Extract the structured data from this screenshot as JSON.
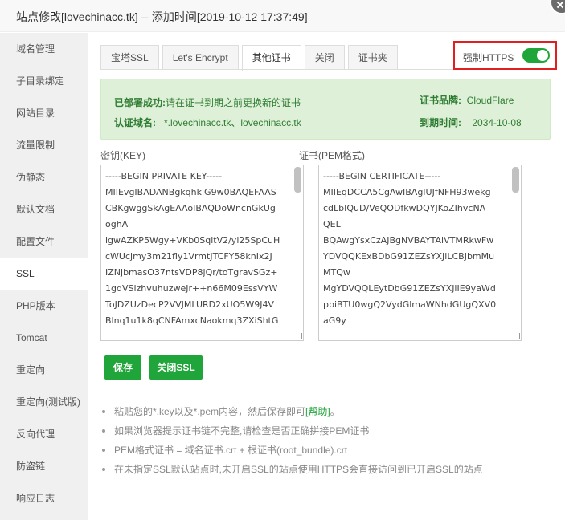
{
  "window": {
    "title": "站点修改[lovechinacc.tk] -- 添加时间[2019-10-12 17:37:49]"
  },
  "sidebar": {
    "items": [
      {
        "label": "域名管理"
      },
      {
        "label": "子目录绑定"
      },
      {
        "label": "网站目录"
      },
      {
        "label": "流量限制"
      },
      {
        "label": "伪静态"
      },
      {
        "label": "默认文档"
      },
      {
        "label": "配置文件"
      },
      {
        "label": "SSL"
      },
      {
        "label": "PHP版本"
      },
      {
        "label": "Tomcat"
      },
      {
        "label": "重定向"
      },
      {
        "label": "重定向(测试版)"
      },
      {
        "label": "反向代理"
      },
      {
        "label": "防盗链"
      },
      {
        "label": "响应日志"
      }
    ],
    "active_item": "SSL"
  },
  "tabs": [
    {
      "label": "宝塔SSL"
    },
    {
      "label": "Let's Encrypt"
    },
    {
      "label": "其他证书"
    },
    {
      "label": "关闭"
    },
    {
      "label": "证书夹"
    }
  ],
  "active_tab": "其他证书",
  "force_https": {
    "label": "强制HTTPS",
    "enabled": true
  },
  "info": {
    "deployed_key": "已部署成功:",
    "deployed_value": "请在证书到期之前更换新的证书",
    "domain_key": "认证域名:",
    "domain_value": "*.lovechinacc.tk、lovechinacc.tk",
    "brand_key": "证书品牌:",
    "brand_value": "CloudFlare",
    "expire_key": "到期时间:",
    "expire_value": "2034-10-08"
  },
  "key_field": {
    "label": "密钥(KEY)",
    "value": "-----BEGIN PRIVATE KEY-----\nMIIEvgIBADANBgkqhkiG9w0BAQEFAAS\nCBKgwggSkAgEAAoIBAQDoWncnGkUg\noghA\nigwAZKP5Wgy+VKb0SqitV2/yl25SpCuH\ncWUcjmy3m21fly1VrmtJTCFY58knIx2J\nIZNjbmasO37ntsVDP8jQr/toTgravSGz+\n1gdVSizhvuhuzweJr++n66M09EssVYW\nToJDZUzDecP2VVJMLURD2xUO5W9J4V\nBlnq1u1k8qCNFAmxcNaokmq3ZXiShtG"
  },
  "cert_field": {
    "label": "证书(PEM格式)",
    "value": "-----BEGIN CERTIFICATE-----\nMIIEqDCCA5CgAwIBAgIUJfNFH93wekg\ncdLbIQuD/VeQODfkwDQYJKoZIhvcNA\nQEL\nBQAwgYsxCzAJBgNVBAYTAlVTMRkwFw\nYDVQQKExBDbG91ZEZsYXJlLCBJbmMu\nMTQw\nMgYDVQQLEytDbG91ZEZsYXJlIE9yaWd\npbiBTU0wgQ2VydGlmaWNhdGUgQXV0\naG9y"
  },
  "buttons": {
    "save": "保存",
    "close_ssl": "关闭SSL"
  },
  "notes": {
    "n1_prefix": "粘贴您的*.key以及*.pem内容，然后保存即可",
    "n1_link": "[帮助]",
    "n1_suffix": "。",
    "n2": "如果浏览器提示证书链不完整,请检查是否正确拼接PEM证书",
    "n3": "PEM格式证书 = 域名证书.crt + 根证书(root_bundle).crt",
    "n4": "在未指定SSL默认站点时,未开启SSL的站点使用HTTPS会直接访问到已开启SSL的站点"
  }
}
